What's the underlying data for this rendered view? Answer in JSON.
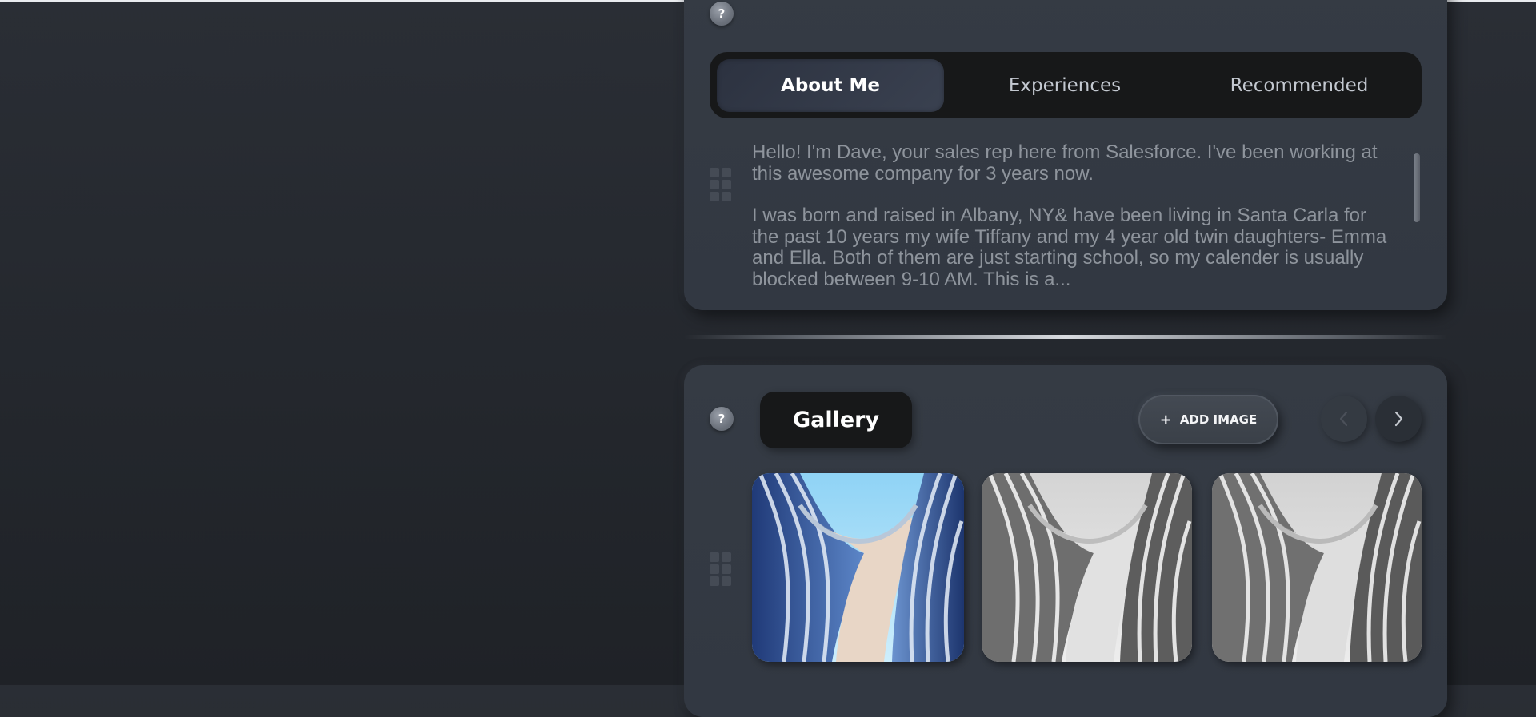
{
  "about": {
    "help_label": "?",
    "tabs": [
      {
        "label": "About Me",
        "active": true
      },
      {
        "label": "Experiences",
        "active": false
      },
      {
        "label": "Recommended",
        "active": false
      }
    ],
    "paragraphs": [
      "Hello! I'm Dave, your sales rep here from Salesforce. I've been working at this awesome company for 3 years now.",
      "I was born and raised in Albany, NY& have been living in Santa Carla for the past 10 years my wife Tiffany and my 4 year old twin daughters- Emma and Ella. Both of them are just starting school, so my calender is usually blocked between 9-10 AM. This is a..."
    ]
  },
  "gallery": {
    "help_label": "?",
    "title": "Gallery",
    "add_image_label": "ADD IMAGE",
    "add_icon": "plus-icon",
    "prev_icon": "chevron-left-icon",
    "next_icon": "chevron-right-icon",
    "images": [
      {
        "name": "building-color",
        "style": "color"
      },
      {
        "name": "building-grayscale",
        "style": "grayscale"
      },
      {
        "name": "building-grayscale-2",
        "style": "grayscale"
      }
    ]
  },
  "colors": {
    "background": "#23262c",
    "panel": "#353b44",
    "tab_bar": "#171819",
    "text_muted": "#8e949c"
  }
}
